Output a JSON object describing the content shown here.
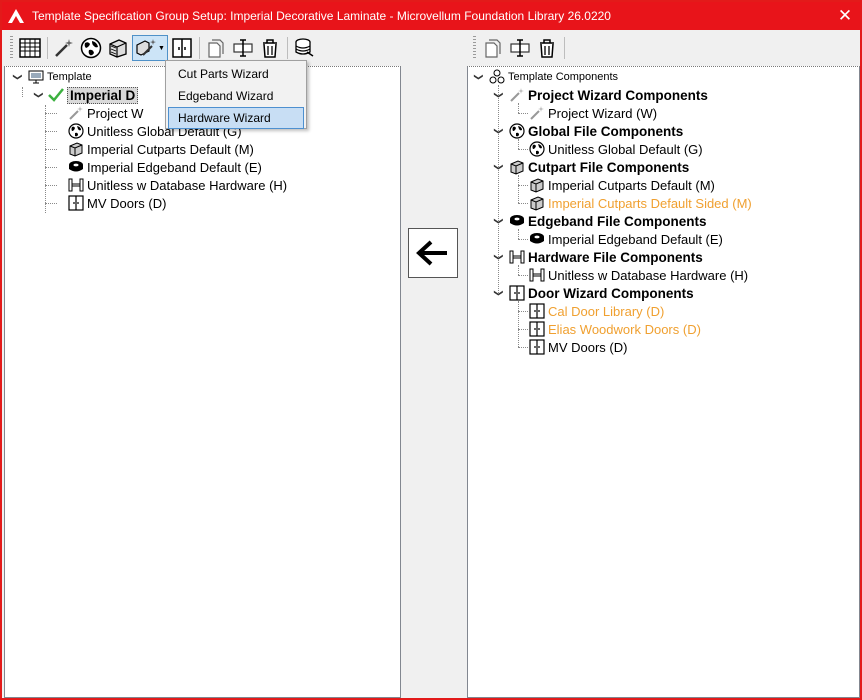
{
  "window": {
    "title": "Template Specification Group Setup: Imperial Decorative Laminate - Microvellum Foundation Library 26.0220",
    "close_glyph": "✕",
    "accent_color": "#e8141a"
  },
  "left_toolbar": {
    "icons": [
      "grid-icon",
      "magic-wand-icon",
      "globe-icon",
      "cube-icon",
      "wand-dropdown-icon",
      "door-icon",
      "copy-icon",
      "rename-icon",
      "delete-icon",
      "database-icon"
    ]
  },
  "dropdown_menu": {
    "items": [
      {
        "label": "Cut Parts Wizard",
        "highlighted": false
      },
      {
        "label": "Edgeband Wizard",
        "highlighted": false
      },
      {
        "label": "Hardware Wizard",
        "highlighted": true
      }
    ]
  },
  "left_tree": {
    "root": "Template",
    "selected": "Imperial Decorative Laminate",
    "selected_visible": "Imperial D",
    "children": [
      {
        "label": "Project W",
        "icon": "wand-icon"
      },
      {
        "label": "Unitless Global Default (G)",
        "icon": "globe-icon"
      },
      {
        "label": "Imperial Cutparts Default (M)",
        "icon": "cube-icon"
      },
      {
        "label": "Imperial Edgeband Default (E)",
        "icon": "edgeband-icon"
      },
      {
        "label": "Unitless w Database Hardware (H)",
        "icon": "hardware-icon"
      },
      {
        "label": "MV Doors (D)",
        "icon": "door-icon"
      }
    ]
  },
  "transfer_button": {
    "glyph": "arrow-left"
  },
  "right_toolbar": {
    "icons": [
      "copy-icon",
      "rename-icon",
      "delete-icon"
    ]
  },
  "right_tree": {
    "root": "Template Components",
    "groups": [
      {
        "label": "Project Wizard Components",
        "icon": "wand-icon",
        "items": [
          {
            "label": "Project Wizard (W)",
            "orange": false,
            "icon": "wand-icon"
          }
        ]
      },
      {
        "label": "Global File Components",
        "icon": "globe-icon",
        "items": [
          {
            "label": "Unitless Global Default (G)",
            "orange": false,
            "icon": "globe-icon"
          }
        ]
      },
      {
        "label": "Cutpart File Components",
        "icon": "cube-icon",
        "items": [
          {
            "label": "Imperial Cutparts Default (M)",
            "orange": false,
            "icon": "cube-icon"
          },
          {
            "label": "Imperial Cutparts Default Sided (M)",
            "orange": true,
            "icon": "cube-icon"
          }
        ]
      },
      {
        "label": "Edgeband File Components",
        "icon": "edgeband-icon",
        "items": [
          {
            "label": "Imperial Edgeband Default (E)",
            "orange": false,
            "icon": "edgeband-icon"
          }
        ]
      },
      {
        "label": "Hardware File Components",
        "icon": "hardware-icon",
        "items": [
          {
            "label": "Unitless w Database Hardware (H)",
            "orange": false,
            "icon": "hardware-icon"
          }
        ]
      },
      {
        "label": "Door Wizard Components",
        "icon": "door-icon",
        "items": [
          {
            "label": "Cal Door Library (D)",
            "orange": true,
            "icon": "door-icon"
          },
          {
            "label": "Elias Woodwork Doors (D)",
            "orange": true,
            "icon": "door-icon"
          },
          {
            "label": "MV Doors (D)",
            "orange": false,
            "icon": "door-icon"
          }
        ]
      }
    ]
  },
  "colors": {
    "orange_text": "#f0a030",
    "highlight": "#c8def4"
  }
}
